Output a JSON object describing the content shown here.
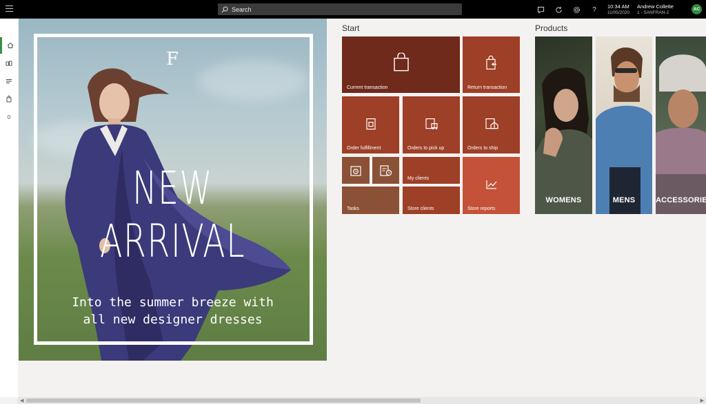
{
  "topbar": {
    "search_placeholder": "Search",
    "time": "10:34 AM",
    "date": "11/05/2020",
    "user_name": "Andrew Collette",
    "store": "1 - SANFRAN-2",
    "avatar_initials": "AC",
    "icons": [
      "hamburger-icon",
      "search-icon",
      "chat-icon",
      "refresh-icon",
      "settings-icon",
      "help-icon"
    ]
  },
  "rail": {
    "items": [
      "home-icon",
      "products-icon",
      "list-icon",
      "bag-icon"
    ],
    "cart_count": "0"
  },
  "hero": {
    "logo": "F",
    "title": "NEW ARRIVAL",
    "subtitle_line1": "Into the summer breeze with",
    "subtitle_line2": "all new designer dresses"
  },
  "start": {
    "title": "Start",
    "tiles": [
      {
        "label": "Current transaction",
        "icon": "shopping-bag-icon",
        "color": "#6f2a1b"
      },
      {
        "label": "Return transaction",
        "icon": "return-bag-icon",
        "color": "#9e3f27"
      },
      {
        "label": "Order fulfillment",
        "icon": "order-fulfillment-icon",
        "color": "#9e3f27"
      },
      {
        "label": "Orders to pick up",
        "icon": "pickup-icon",
        "color": "#9e3f27"
      },
      {
        "label": "Orders to ship",
        "icon": "ship-icon",
        "color": "#9e3f27"
      },
      {
        "label": "",
        "icon": "time-clock-icon",
        "color": "#8a5136"
      },
      {
        "label": "",
        "icon": "schedule-icon",
        "color": "#8a5136"
      },
      {
        "label": "My clients",
        "icon": "",
        "color": "#9e3f27"
      },
      {
        "label": "Tasks",
        "icon": "",
        "color": "#8a5136"
      },
      {
        "label": "Store clients",
        "icon": "",
        "color": "#9e3f27"
      },
      {
        "label": "Store reports",
        "icon": "chart-icon",
        "color": "#c35238"
      }
    ]
  },
  "products": {
    "title": "Products",
    "tiles": [
      {
        "label": "WOMENS"
      },
      {
        "label": "MENS"
      },
      {
        "label": "ACCESSORIES"
      }
    ]
  }
}
